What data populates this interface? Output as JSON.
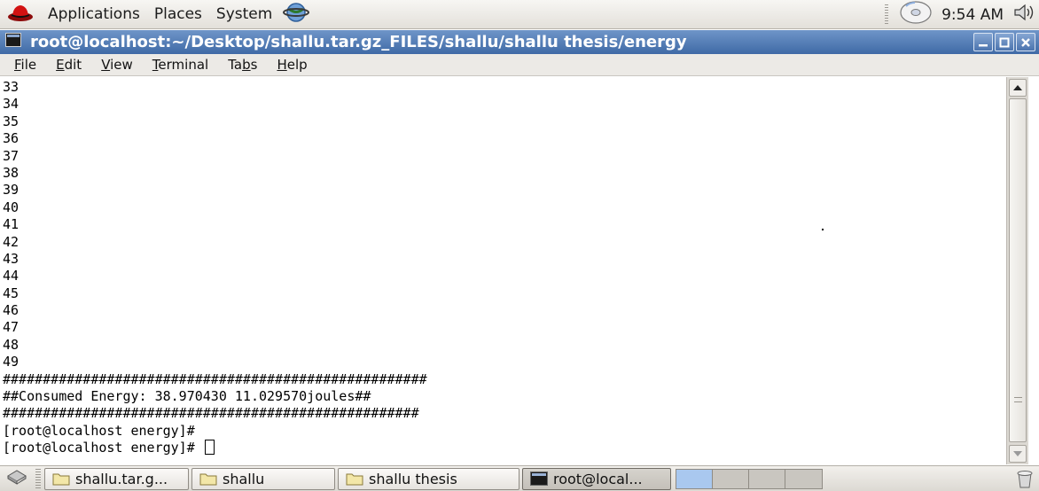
{
  "top_panel": {
    "menus": [
      "Applications",
      "Places",
      "System"
    ],
    "clock": "9:54 AM"
  },
  "window": {
    "title": "root@localhost:~/Desktop/shallu.tar.gz_FILES/shallu/shallu thesis/energy",
    "menu": [
      {
        "pre": "",
        "key": "F",
        "post": "ile"
      },
      {
        "pre": "",
        "key": "E",
        "post": "dit"
      },
      {
        "pre": "",
        "key": "V",
        "post": "iew"
      },
      {
        "pre": "",
        "key": "T",
        "post": "erminal"
      },
      {
        "pre": "Ta",
        "key": "b",
        "post": "s"
      },
      {
        "pre": "",
        "key": "H",
        "post": "elp"
      }
    ]
  },
  "terminal": {
    "lines": [
      "33",
      "34",
      "35",
      "36",
      "37",
      "38",
      "39",
      "40",
      "41",
      "42",
      "43",
      "44",
      "45",
      "46",
      "47",
      "48",
      "49",
      "#####################################################",
      "##Consumed Energy: 38.970430 11.029570joules##",
      "####################################################",
      "[root@localhost energy]#"
    ],
    "prompt": "[root@localhost energy]# "
  },
  "taskbar": {
    "buttons": [
      {
        "label": "shallu.tar.g...",
        "icon": "folder-icon",
        "active": false
      },
      {
        "label": "shallu",
        "icon": "folder-icon",
        "active": false
      },
      {
        "label": "shallu thesis",
        "icon": "folder-icon",
        "active": false
      },
      {
        "label": "root@local...",
        "icon": "terminal-icon",
        "active": true
      }
    ],
    "workspaces": 4,
    "current_workspace": 1
  },
  "colors": {
    "titlebar": "#4a74ad",
    "panel": "#e8e6e1",
    "workspace_current": "#a9c8ef"
  }
}
